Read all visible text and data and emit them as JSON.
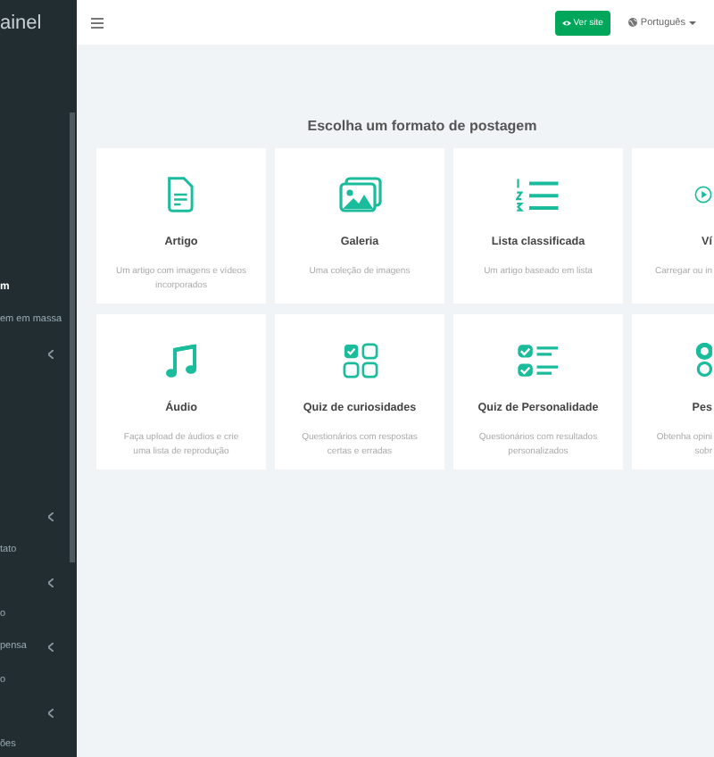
{
  "sidebar": {
    "brand": "ainel",
    "items": [
      {
        "label": "m",
        "selected": true,
        "has_submenu": false
      },
      {
        "label": "em em massa",
        "selected": false,
        "has_submenu": false
      },
      {
        "has_submenu": true
      },
      {
        "has_submenu": false
      },
      {
        "has_submenu": false
      },
      {
        "has_submenu": false
      },
      {
        "has_submenu": false
      },
      {
        "has_submenu": true
      },
      {
        "label": "tato",
        "selected": false,
        "has_submenu": false
      },
      {
        "has_submenu": true
      },
      {
        "label": "o",
        "selected": false,
        "has_submenu": false
      },
      {
        "label": "pensa",
        "selected": false,
        "has_submenu": true
      },
      {
        "label": "o",
        "selected": false,
        "has_submenu": false
      },
      {
        "has_submenu": true
      },
      {
        "label": "ões",
        "selected": false,
        "has_submenu": false
      }
    ]
  },
  "topbar": {
    "view_site": "Ver site",
    "language": "Português"
  },
  "heading": "Escolha um formato de postagem",
  "formats": [
    {
      "title": "Artigo",
      "desc_lines": [
        "Um artigo com imagens e vídeos",
        "incorporados"
      ]
    },
    {
      "title": "Galeria",
      "desc_lines": [
        "Uma coleção de imagens"
      ]
    },
    {
      "title": "Lista classificada",
      "desc_lines": [
        "Um artigo baseado em lista"
      ]
    },
    {
      "title": "Ví",
      "desc_lines": [
        "Carregar ou in"
      ]
    },
    {
      "title": "Áudio",
      "desc_lines": [
        "Faça upload de áudios e crie",
        "uma lista de reprodução"
      ]
    },
    {
      "title": "Quiz de curiosidades",
      "desc_lines": [
        "Questionários com respostas",
        "certas e erradas"
      ]
    },
    {
      "title": "Quiz de Personalidade",
      "desc_lines": [
        "Questionários com resultados",
        "personalizados"
      ]
    },
    {
      "title": "Pes",
      "desc_lines": [
        "Obtenha opini",
        "sobr"
      ]
    }
  ]
}
